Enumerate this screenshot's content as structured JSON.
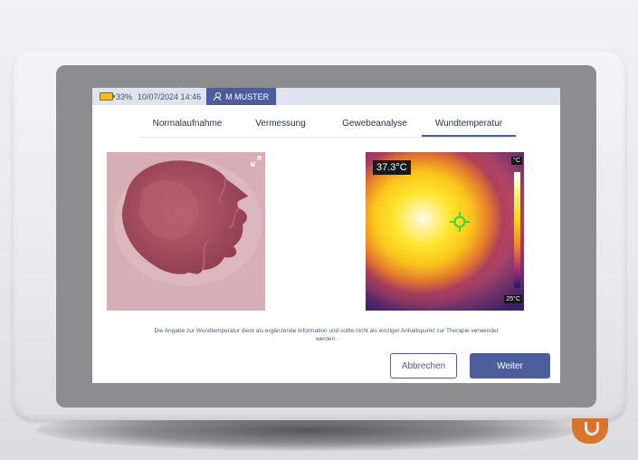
{
  "status": {
    "battery_percent": "33%",
    "datetime": "10/07/2024 14:46",
    "user": "M MUSTER"
  },
  "tabs": [
    {
      "label": "Normalaufnahme",
      "active": false
    },
    {
      "label": "Vermessung",
      "active": false
    },
    {
      "label": "Gewebeanalyse",
      "active": false
    },
    {
      "label": "Wundtemperatur",
      "active": true
    }
  ],
  "thermal": {
    "temperature": "37.3°C",
    "scale_max": "°C",
    "scale_min": "25°C"
  },
  "disclaimer": "Die Angabe zur Wundtemperatur dient als ergänzende Information und sollte nicht als einziger Anhaltspunkt zur Therapie verwendet werden.",
  "buttons": {
    "cancel": "Abbrechen",
    "next": "Weiter"
  },
  "icons": {
    "battery": "battery-icon",
    "user": "user-icon",
    "expand": "expand-icon",
    "crosshair": "crosshair-icon"
  },
  "colors": {
    "accent": "#4d5d9b",
    "statusbar": "#dfe2ef",
    "battery": "#f4bd1b",
    "crosshair": "#3fd23a"
  }
}
